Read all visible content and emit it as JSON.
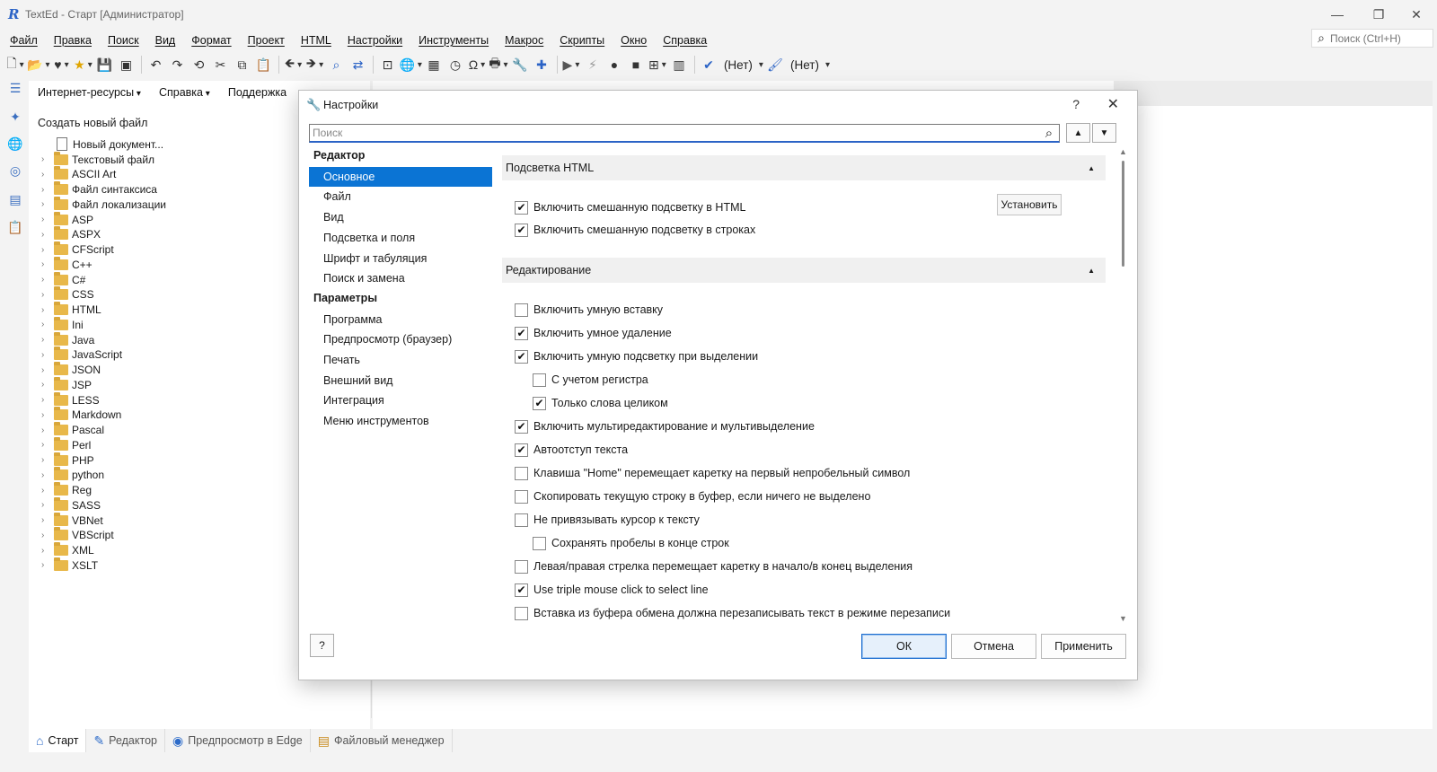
{
  "window": {
    "title": "TextEd - Старт [Администратор]",
    "minimize": "—",
    "maximize": "❐",
    "close": "✕"
  },
  "menu": [
    "Файл",
    "Правка",
    "Поиск",
    "Вид",
    "Формат",
    "Проект",
    "HTML",
    "Настройки",
    "Инструменты",
    "Макрос",
    "Скрипты",
    "Окно",
    "Справка"
  ],
  "global_search": {
    "placeholder": "Поиск (Ctrl+H)"
  },
  "toolbar": {
    "spell_label": "(Нет)",
    "brush_label": "(Нет)"
  },
  "left_panel": {
    "tabs": [
      {
        "label": "Интернет-ресурсы",
        "dropdown": true
      },
      {
        "label": "Справка",
        "dropdown": true
      },
      {
        "label": "Поддержка",
        "dropdown": false
      }
    ],
    "create_new": "Создать новый файл",
    "new_doc": "Новый документ...",
    "folders": [
      "Текстовый файл",
      "ASCII Art",
      "Файл синтаксиса",
      "Файл локализации",
      "ASP",
      "ASPX",
      "CFScript",
      "C++",
      "C#",
      "CSS",
      "HTML",
      "Ini",
      "Java",
      "JavaScript",
      "JSON",
      "JSP",
      "LESS",
      "Markdown",
      "Pascal",
      "Perl",
      "PHP",
      "python",
      "Reg",
      "SASS",
      "VBNet",
      "VBScript",
      "XML",
      "XSLT"
    ]
  },
  "bottom_tabs": [
    {
      "label": "Старт",
      "icon": "home-icon",
      "active": true
    },
    {
      "label": "Редактор",
      "icon": "pencil-icon",
      "active": false
    },
    {
      "label": "Предпросмотр в Edge",
      "icon": "edge-icon",
      "active": false
    },
    {
      "label": "Файловый менеджер",
      "icon": "file-manager-icon",
      "active": false
    }
  ],
  "dialog": {
    "title": "Настройки",
    "help_glyph": "?",
    "close_glyph": "✕",
    "search_placeholder": "Поиск",
    "nav_groups": [
      {
        "head": "Редактор",
        "items": [
          "Основное",
          "Файл",
          "Вид",
          "Подсветка и поля",
          "Шрифт и табуляция",
          "Поиск и замена"
        ]
      },
      {
        "head": "Параметры",
        "items": [
          "Программа",
          "Предпросмотр (браузер)",
          "Печать",
          "Внешний вид",
          "Интеграция",
          "Меню инструментов"
        ]
      }
    ],
    "selected_nav": "Основное",
    "sections": [
      {
        "title": "Подсветка HTML",
        "options": [
          {
            "label": "Включить смешанную подсветку в HTML",
            "checked": true,
            "indent": 0
          },
          {
            "label": "Включить смешанную подсветку в строках",
            "checked": true,
            "indent": 0
          }
        ]
      },
      {
        "title": "Редактирование",
        "options": [
          {
            "label": "Включить умную вставку",
            "checked": false,
            "indent": 0
          },
          {
            "label": "Включить умное удаление",
            "checked": true,
            "indent": 0
          },
          {
            "label": "Включить умную подсветку при выделении",
            "checked": true,
            "indent": 0
          },
          {
            "label": "С учетом регистра",
            "checked": false,
            "indent": 1
          },
          {
            "label": "Только слова целиком",
            "checked": true,
            "indent": 1
          },
          {
            "label": "Включить мультиредактирование и мультивыделение",
            "checked": true,
            "indent": 0
          },
          {
            "label": "Автоотступ текста",
            "checked": true,
            "indent": 0
          },
          {
            "label": "Клавиша \"Home\" перемещает каретку на первый непробельный символ",
            "checked": false,
            "indent": 0
          },
          {
            "label": "Скопировать текущую строку в буфер, если ничего не выделено",
            "checked": false,
            "indent": 0
          },
          {
            "label": "Не привязывать курсор к тексту",
            "checked": false,
            "indent": 0
          },
          {
            "label": "Сохранять пробелы в конце строк",
            "checked": false,
            "indent": 1
          },
          {
            "label": "Левая/правая стрелка перемещает каретку в начало/в конец выделения",
            "checked": false,
            "indent": 0
          },
          {
            "label": "Use triple mouse click to select line",
            "checked": true,
            "indent": 0
          },
          {
            "label": "Вставка из буфера обмена должна перезаписывать текст в режиме перезаписи",
            "checked": false,
            "indent": 0
          }
        ]
      }
    ],
    "install_button": "Установить",
    "ok_button": "ОК",
    "cancel_button": "Отмена",
    "apply_button": "Применить",
    "help_button": "?"
  }
}
